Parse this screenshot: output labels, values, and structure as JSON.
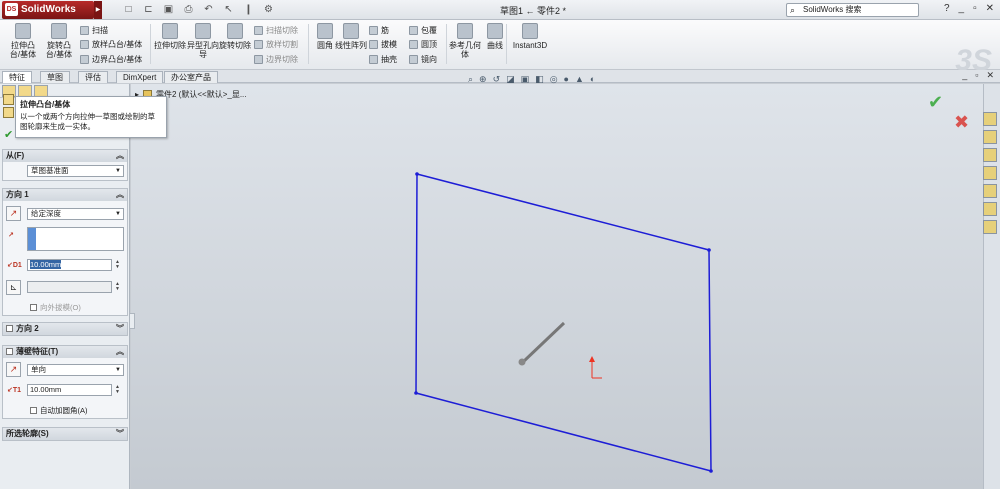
{
  "app": {
    "logo_text": "SolidWorks",
    "logo_badge": "DS",
    "window_title": "草图1 ← 零件2 *",
    "search_placeholder": "SolidWorks 搜索",
    "help": "?"
  },
  "quick_access": [
    "new-icon",
    "open-icon",
    "save-icon",
    "print-icon",
    "undo-icon",
    "select-icon",
    "rebuild-icon",
    "options-icon"
  ],
  "ribbon": {
    "extrude_boss": "拉伸凸台/基体",
    "revolve_boss": "旋转凸台/基体",
    "sweep": "扫描",
    "loft": "放样凸台/基体",
    "boundary_boss": "边界凸台/基体",
    "extrude_cut": "拉伸切除",
    "hole_wizard": "异型孔向导",
    "revolve_cut": "旋转切除",
    "swept_cut": "扫描切除",
    "lofted_cut": "放样切割",
    "boundary_cut": "边界切除",
    "fillet": "圆角",
    "linear_pattern": "线性阵列",
    "rib": "筋",
    "draft": "拔模",
    "shell": "抽壳",
    "wrap": "包覆",
    "dome": "圆顶",
    "mirror": "镜向",
    "ref_geometry": "参考几何体",
    "curves": "曲线",
    "instant3d": "Instant3D"
  },
  "tabs": [
    "特征",
    "草图",
    "评估",
    "DimXpert",
    "办公室产品"
  ],
  "tooltip": {
    "title": "拉伸凸台/基体",
    "body": "以一个或两个方向拉伸一草图或绘制的草图轮廓来生成一实体。"
  },
  "breadcrumb": "零件2 (默认<<默认>_显...",
  "property_manager": {
    "from": {
      "title": "从(F)",
      "value": "草图基准面"
    },
    "direction1": {
      "title": "方向 1",
      "end_condition": "给定深度",
      "depth": "10.00mm",
      "draft_outward": "向外拔模(O)"
    },
    "direction2": {
      "title": "方向 2"
    },
    "thin_feature": {
      "title": "薄壁特征(T)",
      "type": "单向",
      "thickness": "10.00mm",
      "auto_fillet": "自动加圆角(A)"
    },
    "selected_contours": {
      "title": "所选轮廓(S)"
    },
    "dim_labels": {
      "d1": "D1",
      "t1": "T1"
    }
  },
  "colors": {
    "sketch_line": "#1d1dd6",
    "accent_red": "#b32222",
    "ok_green": "#4caf50"
  }
}
